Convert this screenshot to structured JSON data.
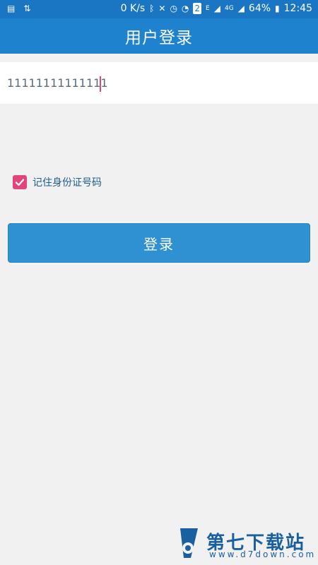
{
  "status_bar": {
    "network_speed": "0 K/s",
    "battery": "64%",
    "time": "12:45",
    "network_type": "4G",
    "sim_badge": "2",
    "edge_badge": "E"
  },
  "app_bar": {
    "title": "用户登录"
  },
  "form": {
    "id_value": "11111111111111",
    "remember_label": "记住身份证号码",
    "remember_checked": true,
    "login_label": "登录"
  },
  "watermark": {
    "name": "第七下载站",
    "url": "www.d7down.com"
  },
  "colors": {
    "status_bar": "#1a76c2",
    "app_bar": "#1e82cf",
    "button": "#2f90d2",
    "checkbox": "#e0457b",
    "background": "#f1f1f1"
  }
}
